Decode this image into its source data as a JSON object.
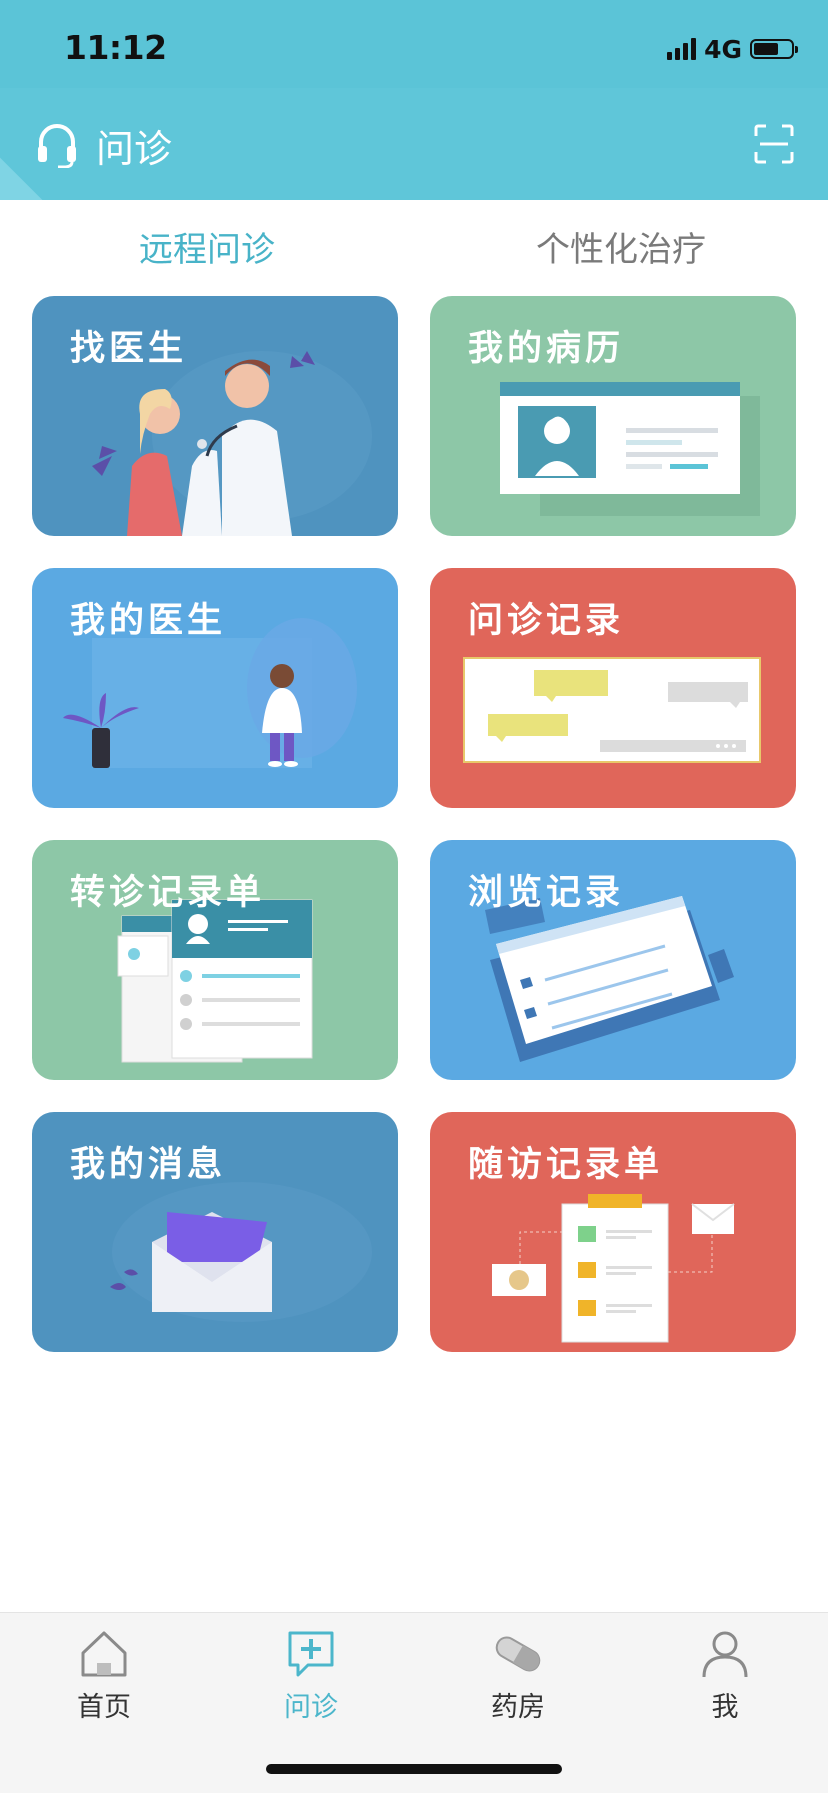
{
  "status": {
    "time": "11:12",
    "network": "4G"
  },
  "header": {
    "title": "问诊",
    "icon": "headset-icon",
    "right_icon": "scan-icon"
  },
  "tabs": [
    {
      "label": "远程问诊",
      "active": true
    },
    {
      "label": "个性化治疗",
      "active": false
    }
  ],
  "cards": [
    {
      "label": "找医生",
      "color": "#4f93bf"
    },
    {
      "label": "我的病历",
      "color": "#8dc7a7"
    },
    {
      "label": "我的医生",
      "color": "#5ba9e2"
    },
    {
      "label": "问诊记录",
      "color": "#e0665a"
    },
    {
      "label": "转诊记录单",
      "color": "#8dc7a7"
    },
    {
      "label": "浏览记录",
      "color": "#5ba9e2"
    },
    {
      "label": "我的消息",
      "color": "#4f93bf"
    },
    {
      "label": "随访记录单",
      "color": "#e0665a"
    }
  ],
  "nav": [
    {
      "label": "首页",
      "icon": "home-icon",
      "active": false
    },
    {
      "label": "问诊",
      "icon": "consult-icon",
      "active": true
    },
    {
      "label": "药房",
      "icon": "pill-icon",
      "active": false
    },
    {
      "label": "我",
      "icon": "user-icon",
      "active": false
    }
  ],
  "colors": {
    "accent": "#4cb6cb",
    "header": "#5fc6d9"
  }
}
